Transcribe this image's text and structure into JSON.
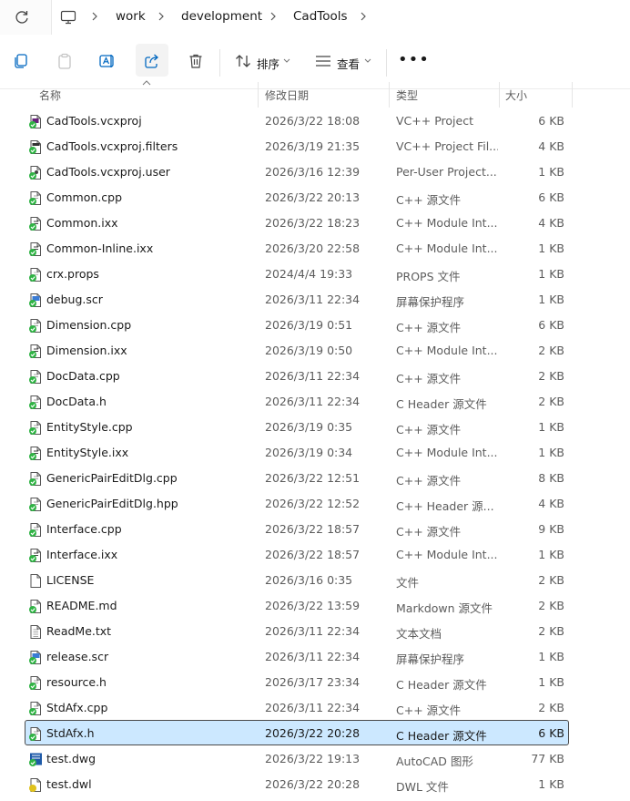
{
  "breadcrumb": {
    "items": [
      "work",
      "development",
      "CadTools"
    ]
  },
  "toolbar": {
    "sort_label": "排序",
    "view_label": "查看",
    "more_label": "•••"
  },
  "columns": {
    "name": "名称",
    "date": "修改日期",
    "type": "类型",
    "size": "大小"
  },
  "colors": {
    "selection_bg": "#cce8ff",
    "accent": "#0067c0",
    "check_green": "#2fb344"
  },
  "files": [
    {
      "name": "CadTools.vcxproj",
      "date": "2026/3/22 18:08",
      "type": "VC++ Project",
      "size": "6 KB",
      "icon": "vcxproj-icon"
    },
    {
      "name": "CadTools.vcxproj.filters",
      "date": "2026/3/19 21:35",
      "type": "VC++ Project Fil...",
      "size": "4 KB",
      "icon": "filters-icon"
    },
    {
      "name": "CadTools.vcxproj.user",
      "date": "2026/3/16 12:39",
      "type": "Per-User Project...",
      "size": "1 KB",
      "icon": "user-file-icon"
    },
    {
      "name": "Common.cpp",
      "date": "2026/3/22 20:13",
      "type": "C++ 源文件",
      "size": "6 KB",
      "icon": "cpp-file-icon"
    },
    {
      "name": "Common.ixx",
      "date": "2026/3/22 18:23",
      "type": "C++ Module Int...",
      "size": "4 KB",
      "icon": "ixx-file-icon"
    },
    {
      "name": "Common-Inline.ixx",
      "date": "2026/3/20 22:58",
      "type": "C++ Module Int...",
      "size": "1 KB",
      "icon": "ixx-file-icon"
    },
    {
      "name": "crx.props",
      "date": "2024/4/4 19:33",
      "type": "PROPS 文件",
      "size": "1 KB",
      "icon": "props-file-icon"
    },
    {
      "name": "debug.scr",
      "date": "2026/3/11 22:34",
      "type": "屏幕保护程序",
      "size": "1 KB",
      "icon": "screensaver-icon"
    },
    {
      "name": "Dimension.cpp",
      "date": "2026/3/19 0:51",
      "type": "C++ 源文件",
      "size": "6 KB",
      "icon": "cpp-file-icon"
    },
    {
      "name": "Dimension.ixx",
      "date": "2026/3/19 0:50",
      "type": "C++ Module Int...",
      "size": "2 KB",
      "icon": "ixx-file-icon"
    },
    {
      "name": "DocData.cpp",
      "date": "2026/3/11 22:34",
      "type": "C++ 源文件",
      "size": "2 KB",
      "icon": "cpp-file-icon"
    },
    {
      "name": "DocData.h",
      "date": "2026/3/11 22:34",
      "type": "C Header 源文件",
      "size": "2 KB",
      "icon": "header-file-icon"
    },
    {
      "name": "EntityStyle.cpp",
      "date": "2026/3/19 0:35",
      "type": "C++ 源文件",
      "size": "1 KB",
      "icon": "cpp-file-icon"
    },
    {
      "name": "EntityStyle.ixx",
      "date": "2026/3/19 0:34",
      "type": "C++ Module Int...",
      "size": "1 KB",
      "icon": "ixx-file-icon"
    },
    {
      "name": "GenericPairEditDlg.cpp",
      "date": "2026/3/22 12:51",
      "type": "C++ 源文件",
      "size": "8 KB",
      "icon": "cpp-file-icon"
    },
    {
      "name": "GenericPairEditDlg.hpp",
      "date": "2026/3/22 12:52",
      "type": "C++ Header 源...",
      "size": "4 KB",
      "icon": "header-file-icon"
    },
    {
      "name": "Interface.cpp",
      "date": "2026/3/22 18:57",
      "type": "C++ 源文件",
      "size": "9 KB",
      "icon": "cpp-file-icon"
    },
    {
      "name": "Interface.ixx",
      "date": "2026/3/22 18:57",
      "type": "C++ Module Int...",
      "size": "1 KB",
      "icon": "ixx-file-icon"
    },
    {
      "name": "LICENSE",
      "date": "2026/3/16 0:35",
      "type": "文件",
      "size": "2 KB",
      "icon": "blank-file-icon"
    },
    {
      "name": "README.md",
      "date": "2026/3/22 13:59",
      "type": "Markdown 源文件",
      "size": "2 KB",
      "icon": "markdown-file-icon"
    },
    {
      "name": "ReadMe.txt",
      "date": "2026/3/11 22:34",
      "type": "文本文档",
      "size": "2 KB",
      "icon": "text-file-icon"
    },
    {
      "name": "release.scr",
      "date": "2026/3/11 22:34",
      "type": "屏幕保护程序",
      "size": "1 KB",
      "icon": "screensaver-icon"
    },
    {
      "name": "resource.h",
      "date": "2026/3/17 23:34",
      "type": "C Header 源文件",
      "size": "1 KB",
      "icon": "header-file-icon"
    },
    {
      "name": "StdAfx.cpp",
      "date": "2026/3/11 22:34",
      "type": "C++ 源文件",
      "size": "2 KB",
      "icon": "cpp-file-icon"
    },
    {
      "name": "StdAfx.h",
      "date": "2026/3/22 20:28",
      "type": "C Header 源文件",
      "size": "6 KB",
      "icon": "header-file-icon",
      "selected": true
    },
    {
      "name": "test.dwg",
      "date": "2026/3/22 19:13",
      "type": "AutoCAD 图形",
      "size": "77 KB",
      "icon": "dwg-file-icon"
    },
    {
      "name": "test.dwl",
      "date": "2026/3/22 20:28",
      "type": "DWL 文件",
      "size": "1 KB",
      "icon": "dwl-file-icon"
    }
  ]
}
